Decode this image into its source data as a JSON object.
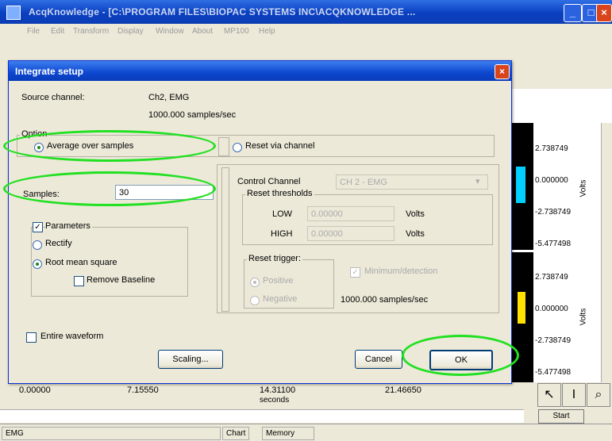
{
  "window": {
    "title": "AcqKnowledge - [C:\\PROGRAM FILES\\BIOPAC SYSTEMS INC\\ACQKNOWLEDGE ..."
  },
  "menu": [
    "File",
    "Edit",
    "Transform",
    "Display",
    "Window",
    "About",
    "MP100",
    "Help"
  ],
  "graph": {
    "scale_top": [
      "2.738749",
      "0.000000",
      "-2.738749",
      "-5.477498"
    ],
    "scale_bottom": [
      "2.738749",
      "0.000000",
      "-2.738749",
      "-5.477498"
    ],
    "unit": "Volts"
  },
  "time_axis": {
    "ticks": [
      "0.00000",
      "7.15550",
      "14.31100",
      "21.46650"
    ],
    "unit": "seconds"
  },
  "status": {
    "channel": "EMG",
    "chart": "Chart",
    "memory": "Memory",
    "start": "Start"
  },
  "dialog": {
    "title": "Integrate setup",
    "source_channel_label": "Source channel:",
    "source_channel_value": "Ch2, EMG",
    "sample_rate": "1000.000 samples/sec",
    "option_legend": "Option",
    "average_label": "Average over samples",
    "reset_via_channel_label": "Reset via channel",
    "samples_label": "Samples:",
    "samples_value": "30",
    "parameters_label": "Parameters",
    "rectify_label": "Rectify",
    "rms_label": "Root mean square",
    "remove_baseline_label": "Remove Baseline",
    "control_channel_label": "Control Channel",
    "control_channel_value": "CH 2 - EMG",
    "reset_thresholds_legend": "Reset thresholds",
    "low_label": "LOW",
    "low_value": "0.00000",
    "high_label": "HIGH",
    "high_value": "0.00000",
    "volts": "Volts",
    "reset_trigger_legend": "Reset trigger:",
    "positive_label": "Positive",
    "negative_label": "Negative",
    "minimum_label": "Minimum/detection",
    "control_sample_rate": "1000.000 samples/sec",
    "entire_waveform_label": "Entire waveform",
    "scaling_label": "Scaling...",
    "cancel_label": "Cancel",
    "ok_label": "OK"
  },
  "highlight_color": "#22e022"
}
